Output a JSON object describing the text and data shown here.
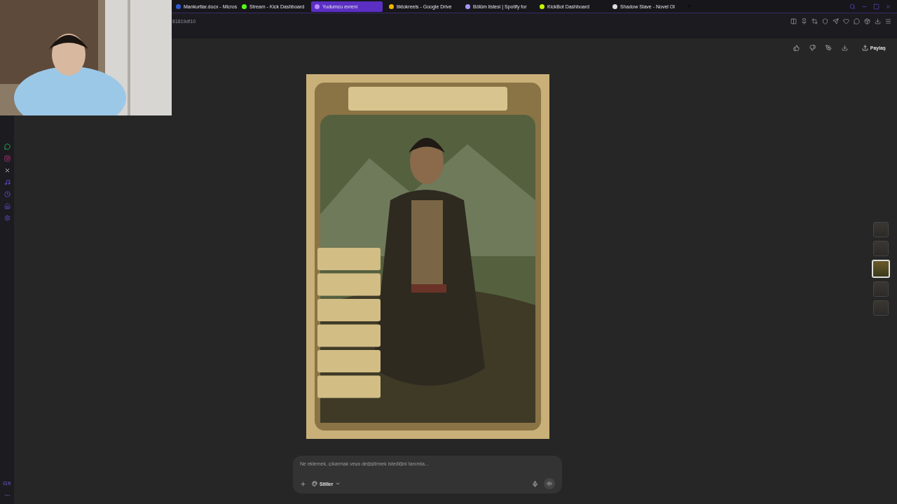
{
  "tabs": [
    {
      "label": "Mankurtlar.docx - Micros",
      "selected": false
    },
    {
      "label": "Stream - Kick Dashboard",
      "selected": false
    },
    {
      "label": "Yudumcu evreni",
      "selected": true
    },
    {
      "label": "tiktokreels - Google Drive",
      "selected": false
    },
    {
      "label": "Bölüm listesi | Spotify for",
      "selected": false
    },
    {
      "label": "KickBot Dashboard",
      "selected": false
    },
    {
      "label": "Shadow Slave - Novel Ol",
      "selected": false
    }
  ],
  "address": {
    "value": "81819df10"
  },
  "actions": {
    "share": "Paylaş"
  },
  "prompt": {
    "placeholder": "Ne eklemek, çıkarmak veya değiştirmek istediğini tanımla...",
    "styles": "Stiller"
  },
  "thumbnails": [
    {
      "selected": false
    },
    {
      "selected": false
    },
    {
      "selected": true
    },
    {
      "selected": false
    },
    {
      "selected": false
    }
  ],
  "sidebar_badge": "GX"
}
